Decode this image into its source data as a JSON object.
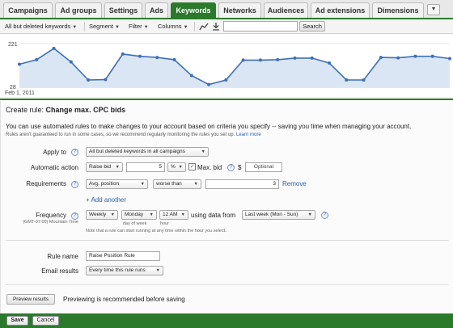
{
  "tabs": [
    "Campaigns",
    "Ad groups",
    "Settings",
    "Ads",
    "Keywords",
    "Networks",
    "Audiences",
    "Ad extensions",
    "Dimensions"
  ],
  "active_tab": "Keywords",
  "toolbar": {
    "filter_view": "All but deleted keywords",
    "segment": "Segment",
    "filter": "Filter",
    "columns": "Columns",
    "search_button": "Search",
    "search_placeholder": ""
  },
  "chart_data": {
    "type": "area",
    "x_label_start": "Feb 1, 2011",
    "y_ticks": [
      "221",
      "28"
    ],
    "ylim": [
      28,
      221
    ],
    "values": [
      130,
      150,
      200,
      140,
      60,
      62,
      175,
      165,
      160,
      150,
      80,
      40,
      60,
      148,
      148,
      150,
      157,
      157,
      135,
      60,
      60,
      160,
      158,
      165,
      165,
      155
    ],
    "color": "#3d6fb6",
    "fill": "#dbe6f4"
  },
  "rule": {
    "title_prefix": "Create rule:",
    "title_bold": "Change max. CPC bids",
    "description": "You can use automated rules to make changes to your account based on criteria you specify -- saving you time when managing your account.",
    "note": "Rules aren't guaranteed to run in some cases, so we recommend regularly monitoring the rules you set up.",
    "note_link": "Learn more",
    "apply_to_label": "Apply to",
    "apply_to_value": "All but deleted keywords in all campaigns",
    "action_label": "Automatic action",
    "action_value": "Raise bid",
    "action_amount": "5",
    "action_unit": "%",
    "max_bid_label": "Max. bid",
    "max_bid_currency": "$",
    "max_bid_value": "Optional",
    "requirements_label": "Requirements",
    "req_metric": "Avg. position",
    "req_operator": "worse than",
    "req_value": "3",
    "remove_link": "Remove",
    "add_another": "+ Add another",
    "frequency_label": "Frequency",
    "timezone": "(GMT-07:00) Mountain Time",
    "freq_period": "Weekly",
    "freq_day": "Monday",
    "freq_hour": "12 AM",
    "day_of_week_hint": "day of week",
    "hour_hint": "hour",
    "using_data_from": "using data from",
    "data_range": "Last week (Mon - Sun)",
    "freq_note": "Note that a rule can start running at any time within the hour you select.",
    "rule_name_label": "Rule name",
    "rule_name_value": "Raise Position Rule",
    "email_label": "Email results",
    "email_value": "Every time this rule runs",
    "preview_button": "Preview results",
    "preview_note": "Previewing is recommended before saving",
    "save_button": "Save",
    "cancel_button": "Cancel"
  }
}
